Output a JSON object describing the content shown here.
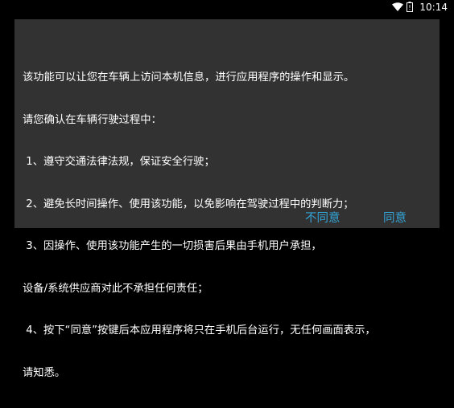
{
  "status_bar": {
    "time": "10:14",
    "icons": [
      "wifi-icon",
      "battery-icon"
    ]
  },
  "dialog": {
    "lines": [
      "该功能可以让您在车辆上访问本机信息，进行应用程序的操作和显示。",
      "请您确认在车辆行驶过程中：",
      " 1、遵守交通法律法规，保证安全行驶；",
      " 2、避免长时间操作、使用该功能，以免影响在驾驶过程中的判断力；",
      " 3、因操作、使用该功能产生的一切损害后果由手机用户承担，",
      "设备/系统供应商对此不承担任何责任；",
      " 4、按下“同意”按键后本应用程序将只在手机后台运行，无任何画面表示，",
      "请知悉。"
    ],
    "disagree_label": "不同意",
    "agree_label": "同意"
  },
  "colors": {
    "dialog_bg": "#323232",
    "button_text": "#33a3d6"
  }
}
